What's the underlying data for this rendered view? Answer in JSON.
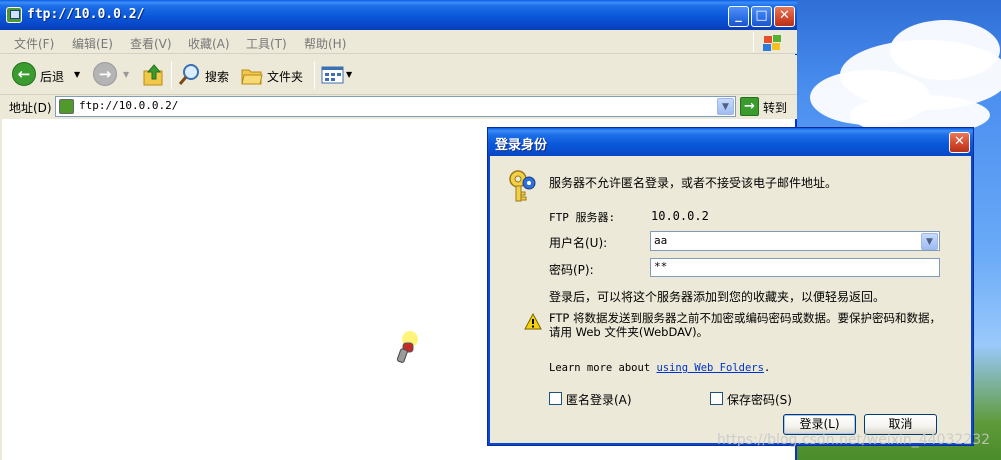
{
  "window": {
    "title": "ftp://10.0.0.2/",
    "minimize": "_",
    "maximize": "□",
    "close": "✕"
  },
  "menu": {
    "items": [
      "文件(F)",
      "编辑(E)",
      "查看(V)",
      "收藏(A)",
      "工具(T)",
      "帮助(H)"
    ]
  },
  "toolbar": {
    "back_label": "后退",
    "search_label": "搜索",
    "folders_label": "文件夹"
  },
  "address": {
    "label": "地址(D)",
    "value": "ftp://10.0.0.2/",
    "go_label": "转到"
  },
  "dialog": {
    "title": "登录身份",
    "message": "服务器不允许匿名登录，或者不接受该电子邮件地址。",
    "server_label": "FTP 服务器:",
    "server_value": "10.0.0.2",
    "username_label": "用户名(U):",
    "username_value": "aa",
    "password_label": "密码(P):",
    "password_value": "**",
    "after_login_text": "登录后，可以将这个服务器添加到您的收藏夹，以便轻易返回。",
    "warning_text": "FTP 将数据发送到服务器之前不加密或编码密码或数据。要保护密码和数据，请用 Web 文件夹(WebDAV)。",
    "learn_prefix": "Learn more about ",
    "learn_link": "using Web Folders",
    "learn_suffix": ".",
    "anonymous_label": "匿名登录(A)",
    "save_password_label": "保存密码(S)",
    "login_button": "登录(L)",
    "cancel_button": "取消"
  },
  "watermark": "https://blog.csdn.net/weixin_44032232",
  "colors": {
    "title_bar": "#0a57d9",
    "dialog_border": "#0a48d0",
    "window_bg": "#ece9d8",
    "link": "#0033cc"
  }
}
